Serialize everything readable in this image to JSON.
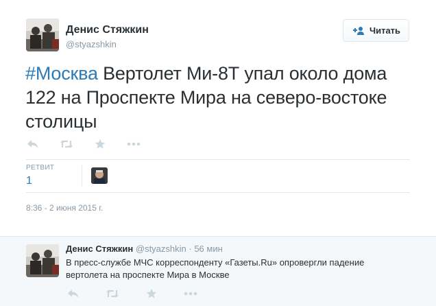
{
  "tweet": {
    "author_name": "Денис Стяжкин",
    "author_handle": "@styazshkin",
    "follow_label": "Читать",
    "hashtag": "#Москва",
    "text": " Вертолет Ми-8Т упал около дома 122 на Проспекте Мира на северо-востоке столицы",
    "actions": [
      "reply-icon",
      "retweet-icon",
      "favorite-icon",
      "more-icon"
    ],
    "retweet_label": "РЕТВИТ",
    "retweet_count": "1",
    "timestamp": "8:36 - 2 июня 2015 г."
  },
  "reply": {
    "author_name": "Денис Стяжкин",
    "author_handle": "@styazshkin",
    "separator": " · ",
    "time": "56 мин",
    "text": "В пресс-службе МЧС корреспонденту «Газеты.Ru» опровергли падение вертолета на проспекте Мира в Москве",
    "actions": [
      "reply-icon",
      "retweet-icon",
      "favorite-icon",
      "more-icon"
    ]
  },
  "colors": {
    "link": "#2b7bb9",
    "text": "#292f33",
    "muted": "#8899a6",
    "icon": "#ccd6dd",
    "reply_bg": "#f5f8fa"
  }
}
